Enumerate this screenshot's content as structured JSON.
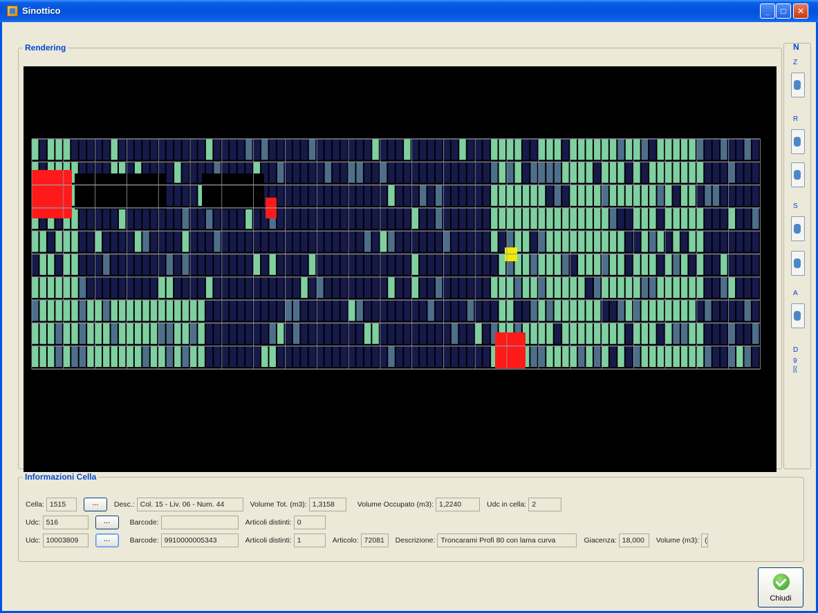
{
  "window": {
    "title": "Sinottico"
  },
  "rendering": {
    "legend": "Rendering",
    "colors": {
      "background": "#000000",
      "empty": "#161a4a",
      "full": "#7fd0a1",
      "partial": "#4e6f8c",
      "alert": "#ff1a1a",
      "selected": "#f0ea00",
      "grid": "#9a9aa8"
    }
  },
  "side_panel": {
    "letters": [
      "N",
      "Z",
      "R",
      "S",
      "A",
      "D",
      "9",
      "[("
    ]
  },
  "info": {
    "legend": "Informazioni Cella",
    "row1": {
      "cella_label": "Cella:",
      "cella_value": "1515",
      "button_label": "...",
      "desc_label": "Desc.:",
      "desc_value": "Col. 15 - Liv. 06 - Num. 44",
      "vol_tot_label": "Volume Tot. (m3):",
      "vol_tot_value": "1,3158",
      "vol_occ_label": "Volume Occupato (m3):",
      "vol_occ_value": "1,2240",
      "udc_cella_label": "Udc in cella:",
      "udc_cella_value": "2"
    },
    "row2": {
      "udc_label": "Udc:",
      "udc_value": "516",
      "button_label": "...",
      "barcode_label": "Barcode:",
      "barcode_value": "",
      "articoli_label": "Articoli distinti:",
      "articoli_value": "0"
    },
    "row3": {
      "udc_label": "Udc:",
      "udc_value": "10003809",
      "button_label": "...",
      "barcode_label": "Barcode:",
      "barcode_value": "9910000005343",
      "articoli_label": "Articoli distinti:",
      "articoli_value": "1",
      "articolo_label": "Articolo:",
      "articolo_value": "72081",
      "descrizione_label": "Descrizione:",
      "descrizione_value": "Troncarami Profi 80 con lama curva",
      "giacenza_label": "Giacenza:",
      "giacenza_value": "18,000",
      "volume_label": "Volume (m3):",
      "volume_value": "("
    }
  },
  "footer": {
    "close_label": "Chiudi"
  }
}
